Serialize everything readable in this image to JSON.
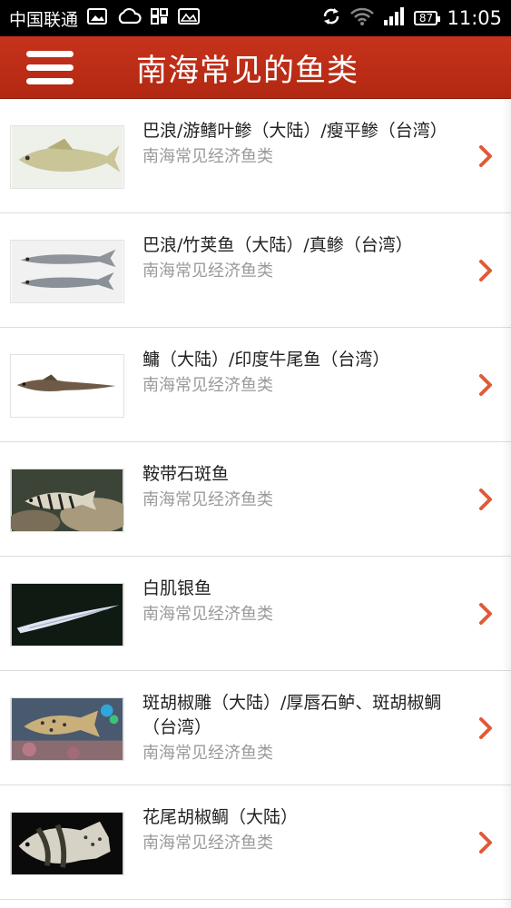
{
  "status_bar": {
    "carrier": "中国联通",
    "battery": "87",
    "time": "11:05"
  },
  "header": {
    "title": "南海常见的鱼类"
  },
  "list": {
    "items": [
      {
        "title": "巴浪/游鳍叶鲹（大陆）/瘦平鲹（台湾）",
        "subtitle": "南海常见经济鱼类"
      },
      {
        "title": "巴浪/竹荚鱼（大陆）/真鲹（台湾）",
        "subtitle": "南海常见经济鱼类"
      },
      {
        "title": "鳙（大陆）/印度牛尾鱼（台湾）",
        "subtitle": "南海常见经济鱼类"
      },
      {
        "title": "鞍带石斑鱼",
        "subtitle": "南海常见经济鱼类"
      },
      {
        "title": "白肌银鱼",
        "subtitle": "南海常见经济鱼类"
      },
      {
        "title": "斑胡椒雕（大陆）/厚唇石鲈、斑胡椒鲷（台湾）",
        "subtitle": "南海常见经济鱼类"
      },
      {
        "title": "花尾胡椒鲷（大陆）",
        "subtitle": "南海常见经济鱼类"
      }
    ]
  },
  "colors": {
    "header": "#b92b15",
    "chevron": "#e05a38"
  }
}
